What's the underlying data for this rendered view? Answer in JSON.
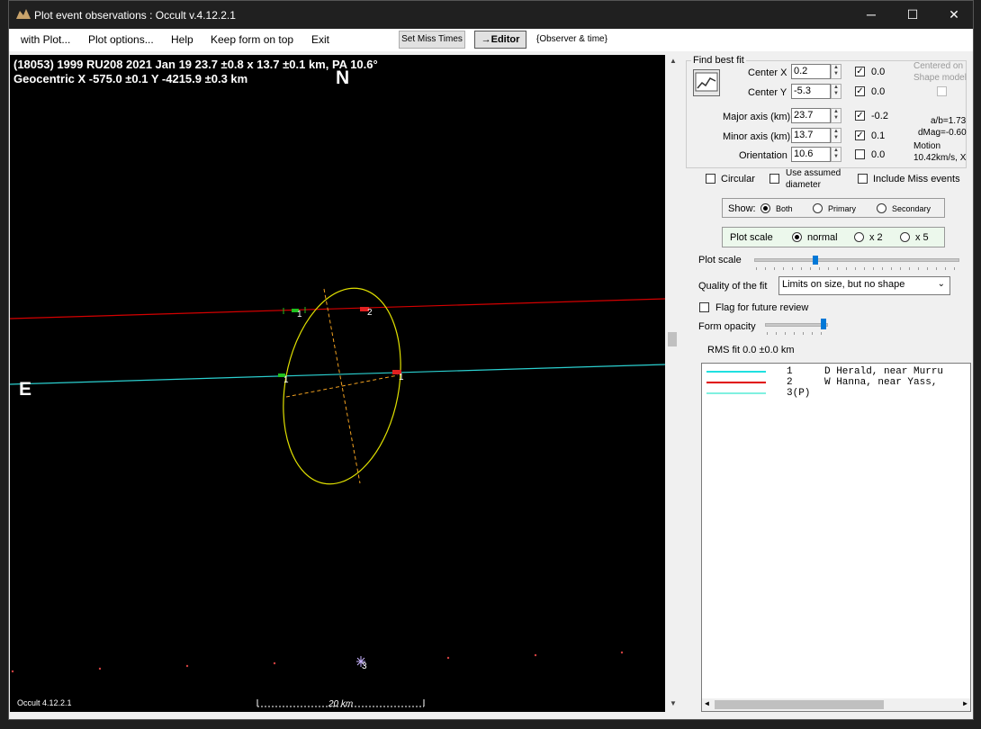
{
  "window": {
    "title": "Plot event observations : Occult v.4.12.2.1",
    "minimize": "─",
    "maximize": "☐",
    "close": "✕"
  },
  "menu": {
    "items": [
      "with Plot...",
      "Plot options...",
      "Help",
      "Keep form on top",
      "Exit"
    ],
    "set_miss_times": "Set Miss Times",
    "editor": "→Editor",
    "observer_time": "{Observer & time}"
  },
  "plot": {
    "header_line1": "(18053) 1999 RU208  2021 Jan 19  23.7 ±0.8 x 13.7 ±0.1 km, PA 10.6°",
    "header_line2": "Geocentric  X  -575.0 ±0.1  Y -4215.9 ±0.3 km",
    "north_label": "N",
    "east_label": "E",
    "footer_version": "Occult 4.12.2.1",
    "scale_label": "20 km",
    "chord_labels": [
      "1",
      "2",
      "2",
      "1",
      "1"
    ],
    "star_label": "3",
    "colors": {
      "chord_red": "#d40000",
      "chord_cyan": "#2bd0d0",
      "ellipse": "#e0e000",
      "axes": "#f0a020"
    }
  },
  "fit": {
    "group_title": "Find best fit",
    "center_x_label": "Center X",
    "center_x": "0.2",
    "center_y_label": "Center Y",
    "center_y": "-5.3",
    "major_label": "Major axis (km)",
    "major": "23.7",
    "minor_label": "Minor axis (km)",
    "minor": "13.7",
    "orient_label": "Orientation",
    "orient": "10.6",
    "cx_delta": "0.0",
    "cy_delta": "0.0",
    "major_delta": "-0.2",
    "minor_delta": "0.1",
    "orient_delta": "0.0",
    "centered_on": "Centered on",
    "shape_model": "Shape model",
    "ab_ratio": "a/b=1.73",
    "dmag": "dMag=-0.60",
    "motion": "Motion",
    "motion_val": "10.42km/s, X",
    "circular": "Circular",
    "use_assumed": "Use assumed",
    "diameter": "diameter",
    "include_miss": "Include Miss events"
  },
  "show": {
    "label": "Show:",
    "both": "Both",
    "primary": "Primary",
    "secondary": "Secondary"
  },
  "plotscale": {
    "label": "Plot scale",
    "normal": "normal",
    "x2": "x 2",
    "x5": "x 5",
    "slider_label": "Plot scale",
    "slider_value": 0.3
  },
  "quality": {
    "label": "Quality of the fit",
    "value": "Limits on size, but no shape"
  },
  "flag_label": "Flag for future review",
  "opacity": {
    "label": "Form opacity",
    "value": 0.95
  },
  "rms": "RMS fit  0.0 ±0.0 km",
  "legend": [
    {
      "num": "1",
      "text": "D Herald, near Murru",
      "color": "#20e0e0"
    },
    {
      "num": "2",
      "text": "W Hanna, near Yass,",
      "color": "#e00000"
    },
    {
      "num": "3(P)",
      "text": "",
      "color": "#80f0e0"
    }
  ]
}
